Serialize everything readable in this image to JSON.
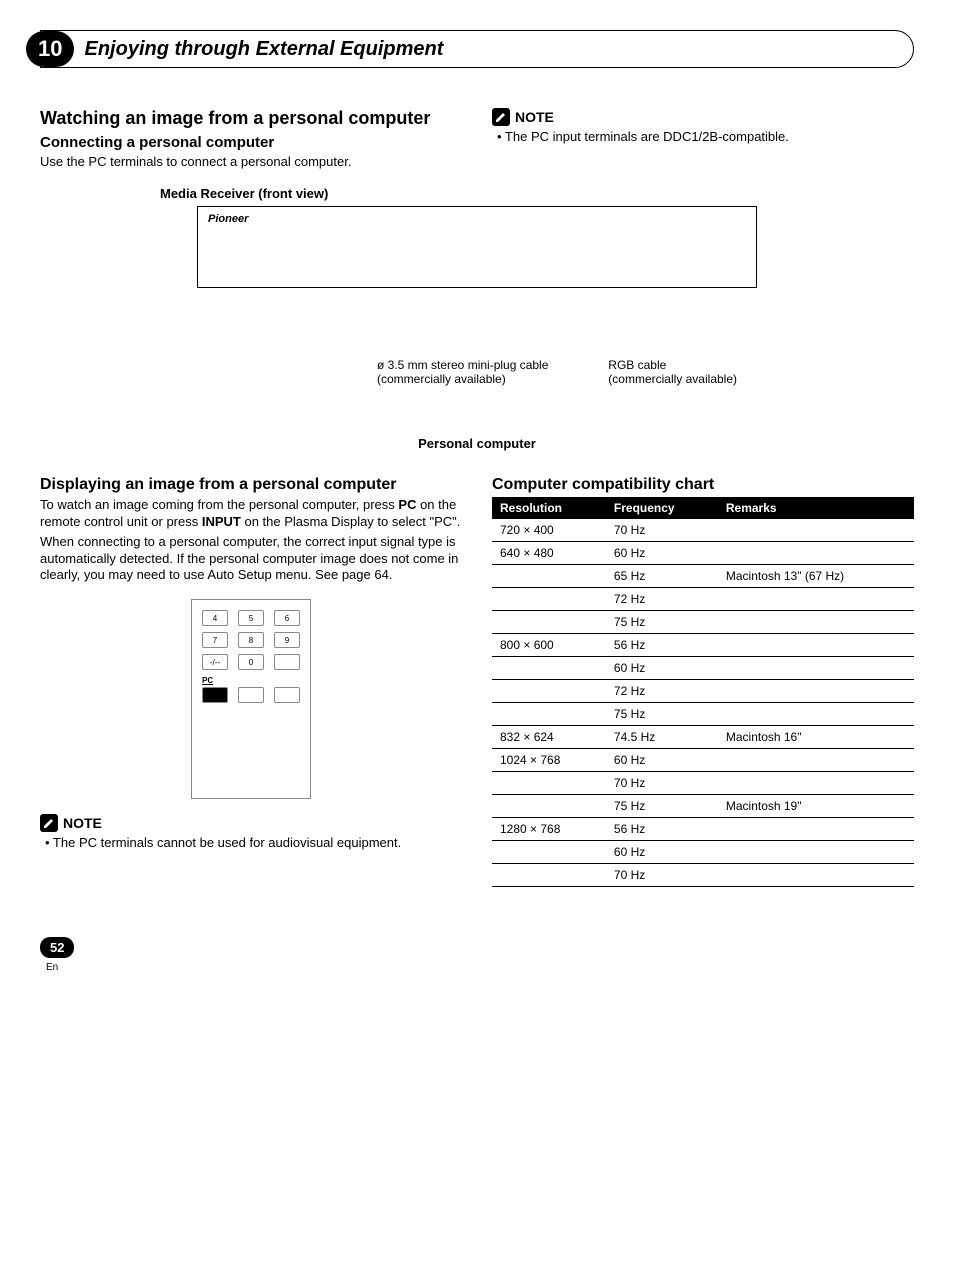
{
  "chapter": {
    "number": "10",
    "title": "Enjoying through External Equipment"
  },
  "left_col": {
    "heading": "Watching an image from a personal computer",
    "subheading": "Connecting a personal computer",
    "body": "Use the PC terminals to connect a personal computer."
  },
  "right_col_top": {
    "note_label": "NOTE",
    "note_body": "• The PC input terminals are DDC1/2B-compatible."
  },
  "diagram": {
    "receiver_caption": "Media Receiver (front view)",
    "brand": "Pioneer",
    "cable_left_line1": "ø 3.5 mm stereo mini-plug cable",
    "cable_left_line2": "(commercially available)",
    "cable_right_line1": "RGB cable",
    "cable_right_line2": "(commercially available)",
    "pc_caption": "Personal computer"
  },
  "displaying": {
    "heading": "Displaying an image from a personal computer",
    "body1_a": "To watch an image coming from the personal computer, press ",
    "body1_b": "PC",
    "body1_c": " on the remote control unit or press ",
    "body1_d": "INPUT",
    "body1_e": " on the Plasma Display to select \"PC\".",
    "body2": "When connecting to a personal computer, the correct input signal type is automatically detected. If the personal computer image does not come in clearly, you may need to use Auto Setup menu. See page 64.",
    "remote_buttons": {
      "r1": [
        "4",
        "5",
        "6"
      ],
      "r2": [
        "7",
        "8",
        "9"
      ],
      "r3": [
        "-/--",
        "0",
        ""
      ],
      "pc_label": "PC"
    },
    "note_label": "NOTE",
    "note_body": "• The PC terminals cannot be used for audiovisual equipment."
  },
  "compat": {
    "heading": "Computer compatibility chart",
    "headers": [
      "Resolution",
      "Frequency",
      "Remarks"
    ],
    "chart_data": {
      "type": "table",
      "columns": [
        "Resolution",
        "Frequency",
        "Remarks"
      ],
      "rows": [
        [
          "720 × 400",
          "70 Hz",
          ""
        ],
        [
          "640 × 480",
          "60 Hz",
          ""
        ],
        [
          "",
          "65 Hz",
          "Macintosh 13\" (67 Hz)"
        ],
        [
          "",
          "72 Hz",
          ""
        ],
        [
          "",
          "75 Hz",
          ""
        ],
        [
          "800 × 600",
          "56 Hz",
          ""
        ],
        [
          "",
          "60 Hz",
          ""
        ],
        [
          "",
          "72 Hz",
          ""
        ],
        [
          "",
          "75 Hz",
          ""
        ],
        [
          "832 × 624",
          "74.5 Hz",
          "Macintosh 16\""
        ],
        [
          "1024 × 768",
          "60 Hz",
          ""
        ],
        [
          "",
          "70 Hz",
          ""
        ],
        [
          "",
          "75 Hz",
          "Macintosh 19\""
        ],
        [
          "1280 × 768",
          "56 Hz",
          ""
        ],
        [
          "",
          "60 Hz",
          ""
        ],
        [
          "",
          "70 Hz",
          ""
        ]
      ]
    }
  },
  "footer": {
    "page_number": "52",
    "lang": "En"
  }
}
